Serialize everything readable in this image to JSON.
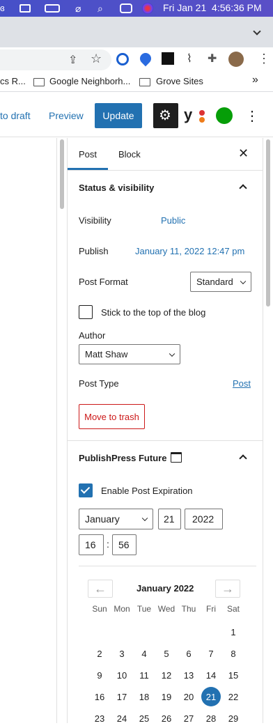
{
  "menubar": {
    "date_time": "Fri Jan 21  4:56:36 PM"
  },
  "bookmarks": {
    "items": [
      "cs R...",
      "Google Neighborh...",
      "Grove Sites"
    ],
    "more": "»"
  },
  "header": {
    "save_draft": "to draft",
    "preview": "Preview",
    "update": "Update"
  },
  "sidebar": {
    "tabs": {
      "post": "Post",
      "block": "Block"
    },
    "status": {
      "title": "Status & visibility",
      "visibility_label": "Visibility",
      "visibility_value": "Public",
      "publish_label": "Publish",
      "publish_value": "January 11, 2022 12:47 pm",
      "format_label": "Post Format",
      "format_value": "Standard",
      "sticky_label": "Stick to the top of the blog",
      "author_label": "Author",
      "author_value": "Matt Shaw",
      "type_label": "Post Type",
      "type_value": "Post",
      "trash": "Move to trash"
    },
    "future": {
      "title": "PublishPress Future",
      "enable_label": "Enable Post Expiration",
      "month": "January",
      "day": "21",
      "year": "2022",
      "hour": "16",
      "minute": "56",
      "sep": ":",
      "cal_title": "January 2022",
      "weekdays": [
        "Sun",
        "Mon",
        "Tue",
        "Wed",
        "Thu",
        "Fri",
        "Sat"
      ],
      "selected_day": "21"
    }
  },
  "colors": {
    "accent": "#2271b1",
    "trash": "#cc1818",
    "selected": "#2271b1"
  }
}
